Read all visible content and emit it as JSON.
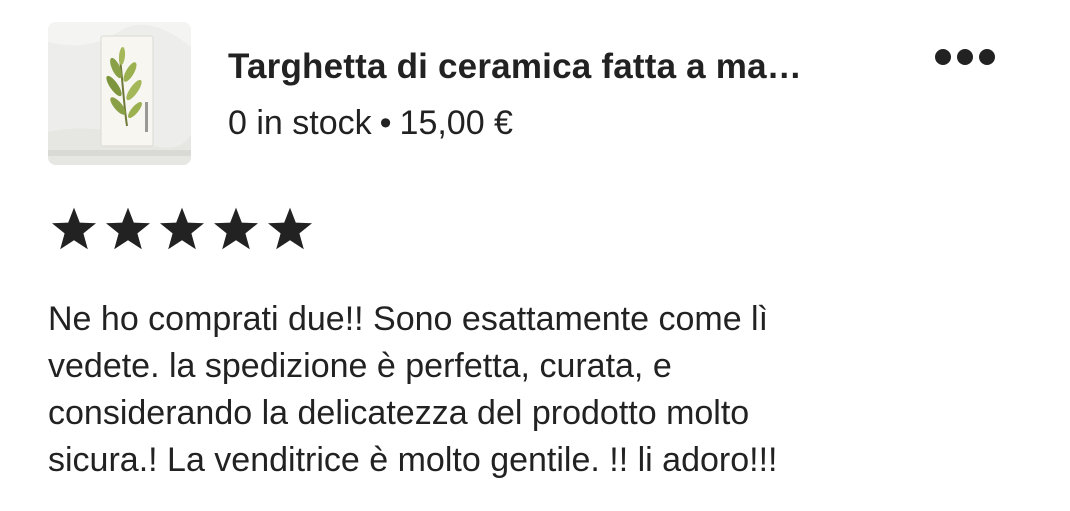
{
  "listing": {
    "title": "Targhetta di ceramica fatta a ma…",
    "stock": "0 in stock",
    "separator": "•",
    "price": "15,00 €",
    "thumbnail_icon": "ceramic-plaque-photo",
    "more_icon": "more-dots-icon"
  },
  "rating": {
    "stars": 5,
    "max": 5,
    "color": "#222222"
  },
  "review": {
    "lines": [
      "Ne ho comprati due!! Sono esattamente come lì",
      "vedete. la spedizione è perfetta, curata, e",
      "considerando la delicatezza del prodotto molto",
      "sicura.! La venditrice è molto gentile. !! li adoro!!!"
    ]
  }
}
